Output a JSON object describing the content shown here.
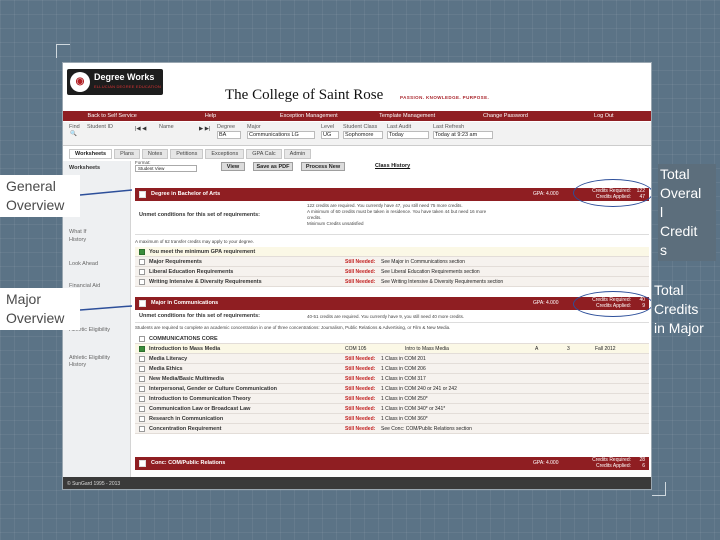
{
  "app": {
    "product_name": "Degree Works",
    "product_sub": "ELLUCIAN DEGREE EDUCATION",
    "college": "The College of Saint Rose",
    "tagline": "PASSION. KNOWLEDGE. PURPOSE."
  },
  "topnav": [
    "Back to Self Service",
    "Help",
    "Exception Management",
    "Template Management",
    "Change Password",
    "Log Out"
  ],
  "search": {
    "find_label": "Find",
    "id_label": "Student ID",
    "name_label": "Name",
    "degree_label": "Degree",
    "degree_value": "BA",
    "major_label": "Major",
    "major_value": "Communications LG",
    "level_label": "Level",
    "level_value": "UG",
    "class_label": "Student Class",
    "class_value": "Sophomore",
    "audit_label": "Last Audit",
    "audit_value": "Today",
    "refresh_label": "Last Refresh",
    "refresh_value": "Today at 9:23 am"
  },
  "tabs": [
    "Worksheets",
    "Plans",
    "Notes",
    "Petitions",
    "Exceptions",
    "GPA Calc",
    "Admin"
  ],
  "sidebar": [
    "Worksheets",
    "What If",
    "History",
    "Look Ahead",
    "Financial Aid",
    "Athletic Eligibility",
    "Athletic Eligibility History"
  ],
  "controls": {
    "format_label": "Format:",
    "format_value": "Student View",
    "view": "View",
    "save_pdf": "Save as PDF",
    "process_new": "Process New",
    "class_history": "Class History"
  },
  "degree_block": {
    "title": "Degree in Bachelor of Arts",
    "gpa_label": "GPA:",
    "gpa": "4.000",
    "credits_required_label": "Credits Required:",
    "credits_required": "122",
    "credits_applied_label": "Credits Applied:",
    "credits_applied": "47",
    "unmet_header": "Unmet conditions for this set of requirements:",
    "unmet_lines": [
      "122 credits are required. You currently have 47, you still need 75 more credits.",
      "A minimum of 60 credits must be taken in residence. You have taken 44 but need 16 more",
      "credits.",
      "Minimum Credits unsatisfied"
    ],
    "transfer_note": "A maximum of 62 transfer credits may apply to your degree.",
    "rows": [
      {
        "name": "You meet the minimum GPA requirement",
        "status": "",
        "detail": ""
      },
      {
        "name": "Major Requirements",
        "status": "Still Needed:",
        "detail": "See Major in Communications section"
      },
      {
        "name": "Liberal Education Requirements",
        "status": "Still Needed:",
        "detail": "See Liberal Education Requirements section"
      },
      {
        "name": "Writing Intensive & Diversity Requirements",
        "status": "Still Needed:",
        "detail": "See Writing Intensive & Diversity Requirements section"
      }
    ]
  },
  "major_block": {
    "title": "Major in Communications",
    "gpa_label": "GPA:",
    "gpa": "4.000",
    "credits_required_label": "Credits Required:",
    "credits_required": "40",
    "credits_applied_label": "Credits Applied:",
    "credits_applied": "9",
    "unmet_header": "Unmet conditions for this set of requirements:",
    "unmet_line": "40-51 credits are required. You currently have 9, you still need 40 more credits.",
    "conc_note": "Students are required to complete an academic concentration in one of three concentrations: Journalism, Public Relations & Advertising, or Film & New Media.",
    "section_label": "COMMUNICATIONS CORE",
    "course_row": {
      "name": "Introduction to Mass Media",
      "course": "COM 105",
      "title": "Intro to Mass Media",
      "grade": "A",
      "credits": "3",
      "term": "Fall 2012"
    },
    "rows": [
      {
        "name": "Media Literacy",
        "detail": "1 Class in COM 201"
      },
      {
        "name": "Media Ethics",
        "detail": "1 Class in COM 206"
      },
      {
        "name": "New Media/Basic Multimedia",
        "detail": "1 Class in COM 317"
      },
      {
        "name": "Interpersonal, Gender or Culture Communication",
        "detail": "1 Class in COM 240 or 241 or 242"
      },
      {
        "name": "Introduction to Communication Theory",
        "detail": "1 Class in COM 250*"
      },
      {
        "name": "Communication Law or Broadcast Law",
        "detail": "1 Class in COM 340* or 341*"
      },
      {
        "name": "Research in Communication",
        "detail": "1 Class in COM 360*"
      },
      {
        "name": "Concentration Requirement",
        "detail": "See Conc: COM/Public Relations section"
      }
    ],
    "still_needed": "Still Needed:"
  },
  "conc_block": {
    "title": "Conc: COM/Public Relations",
    "gpa_label": "GPA:",
    "gpa": "4.000",
    "credits_required_label": "Credits Required:",
    "credits_required": "28",
    "credits_applied_label": "Credits Applied:",
    "credits_applied": "6"
  },
  "footer": "© SunGard 1995 - 2013",
  "annotations": {
    "general": "General Overview",
    "major": "Major Overview",
    "total_credits": [
      "Total",
      "Overal",
      "l",
      "Credit",
      "s"
    ],
    "total_major": [
      "Total",
      "Credits",
      "in Major"
    ]
  },
  "colors": {
    "brand": "#8f1e22",
    "ring": "#2d4f9a",
    "still_needed": "#c21e1e"
  }
}
